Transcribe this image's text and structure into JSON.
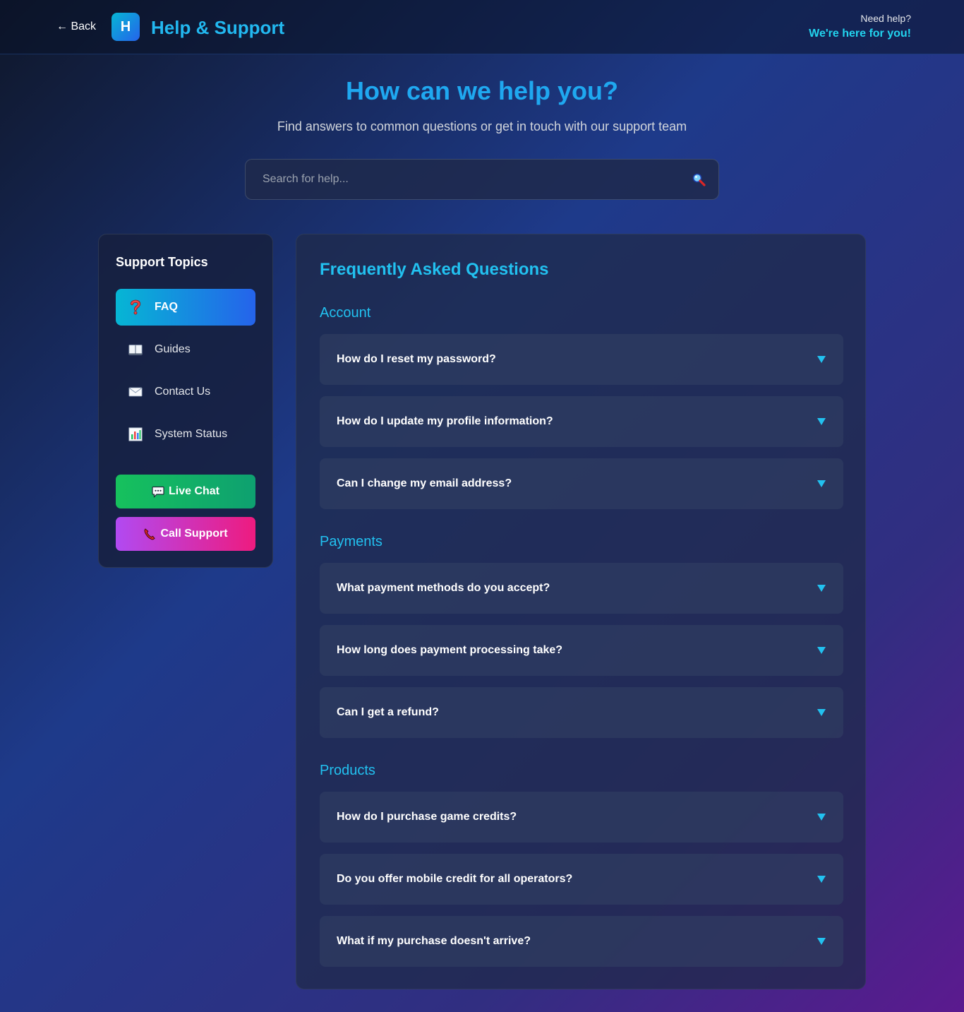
{
  "header": {
    "back_label": "← Back",
    "logo_letter": "H",
    "title": "Help & Support",
    "need_help": "Need help?",
    "here_for_you": "We're here for you!"
  },
  "hero": {
    "title": "How can we help you?",
    "subtitle": "Find answers to common questions or get in touch with our support team",
    "search_placeholder": "Search for help...",
    "search_icon": "magnifier-icon"
  },
  "sidebar": {
    "title": "Support Topics",
    "items": [
      {
        "label": "FAQ",
        "icon": "question-icon",
        "active": true
      },
      {
        "label": "Guides",
        "icon": "book-icon",
        "active": false
      },
      {
        "label": "Contact Us",
        "icon": "envelope-icon",
        "active": false
      },
      {
        "label": "System Status",
        "icon": "bar-chart-icon",
        "active": false
      }
    ],
    "live_chat_label": "Live Chat",
    "call_support_label": "Call Support"
  },
  "main": {
    "title": "Frequently Asked Questions",
    "categories": [
      {
        "name": "Account",
        "questions": [
          "How do I reset my password?",
          "How do I update my profile information?",
          "Can I change my email address?"
        ]
      },
      {
        "name": "Payments",
        "questions": [
          "What payment methods do you accept?",
          "How long does payment processing take?",
          "Can I get a refund?"
        ]
      },
      {
        "name": "Products",
        "questions": [
          "How do I purchase game credits?",
          "Do you offer mobile credit for all operators?",
          "What if my purchase doesn't arrive?"
        ]
      }
    ]
  },
  "colors": {
    "accent": "#22c1f0",
    "active_gradient_start": "#06b6d4",
    "active_gradient_end": "#2563eb",
    "live_chat": "#16c15d",
    "call_support": "#ee1b7f"
  }
}
